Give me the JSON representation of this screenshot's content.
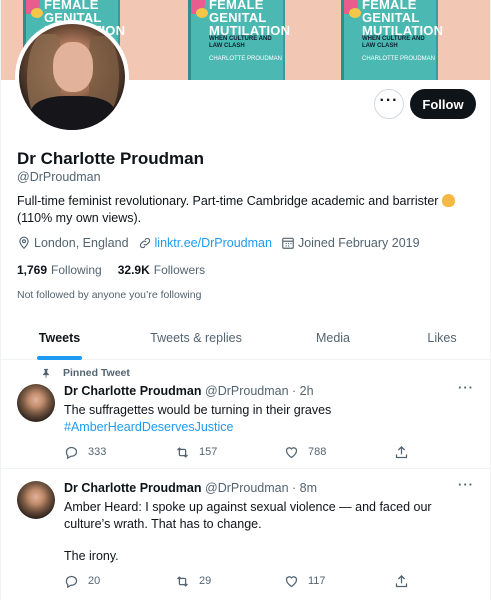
{
  "banner": {
    "book_title_line1": "FEMALE",
    "book_title_line2": "GENITAL",
    "book_title_line3": "MUTILATION",
    "book_subtitle": "WHEN CULTURE AND LAW CLASH",
    "book_author": "CHARLOTTE PROUDMAN",
    "background_color": "#f2c7b3",
    "book_color": "#4cb8b2"
  },
  "profile": {
    "name": "Dr Charlotte Proudman",
    "handle": "@DrProudman",
    "bio_line1": "Full-time feminist revolutionary. Part-time Cambridge academic and barrister",
    "bio_line2": "(110% my own views).",
    "location": "London, England",
    "link": "linktr.ee/DrProudman",
    "joined": "Joined February 2019",
    "following_count": "1,769",
    "following_label": "Following",
    "followers_count": "32.9K",
    "followers_label": "Followers",
    "not_followed": "Not followed by anyone you’re following",
    "more_label": "···",
    "follow_label": "Follow"
  },
  "tabs": [
    "Tweets",
    "Tweets & replies",
    "Media",
    "Likes"
  ],
  "tweets": [
    {
      "pinned_label": "Pinned Tweet",
      "author": "Dr Charlotte Proudman",
      "handle": "@DrProudman",
      "time": "· 2h",
      "text_line1": "The suffragettes would be turning in their graves",
      "hashtag": "#AmberHeardDeservesJustice",
      "replies": "333",
      "retweets": "157",
      "likes": "788"
    },
    {
      "author": "Dr Charlotte Proudman",
      "handle": "@DrProudman",
      "time": "· 8m",
      "text_line1": "Amber Heard: I spoke up against sexual violence — and faced our culture’s wrath. That has to change.",
      "text_line2": "The irony.",
      "replies": "20",
      "retweets": "29",
      "likes": "117"
    }
  ],
  "colors": {
    "accent": "#1d9bf0",
    "text": "#0f1419",
    "muted": "#536471",
    "border": "#eff3f4"
  }
}
